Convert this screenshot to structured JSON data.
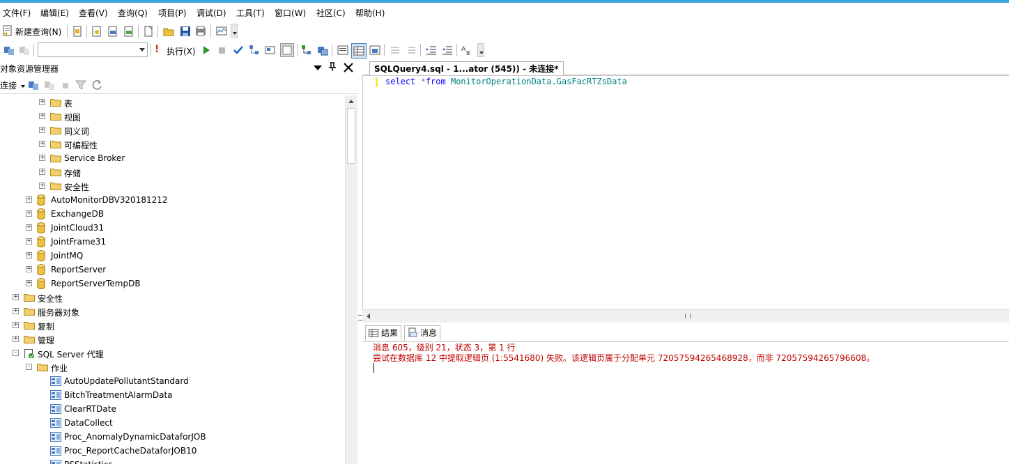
{
  "menu": [
    "文件(F)",
    "编辑(E)",
    "查看(V)",
    "查询(Q)",
    "项目(P)",
    "调试(D)",
    "工具(T)",
    "窗口(W)",
    "社区(C)",
    "帮助(H)"
  ],
  "toolbar1": {
    "new_query": "新建查询(N)"
  },
  "toolbar2": {
    "execute": "执行(X)",
    "database_select": ""
  },
  "object_explorer": {
    "title": "对象资源管理器",
    "connect": "连接",
    "nodes": [
      {
        "label": "表",
        "type": "folder"
      },
      {
        "label": "视图",
        "type": "folder"
      },
      {
        "label": "同义词",
        "type": "folder"
      },
      {
        "label": "可编程性",
        "type": "folder"
      },
      {
        "label": "Service Broker",
        "type": "folder"
      },
      {
        "label": "存储",
        "type": "folder"
      },
      {
        "label": "安全性",
        "type": "folder"
      },
      {
        "label": "AutoMonitorDBV320181212",
        "type": "db"
      },
      {
        "label": "ExchangeDB",
        "type": "db"
      },
      {
        "label": "JointCloud31",
        "type": "db"
      },
      {
        "label": "JointFrame31",
        "type": "db"
      },
      {
        "label": "JointMQ",
        "type": "db"
      },
      {
        "label": "ReportServer",
        "type": "db"
      },
      {
        "label": "ReportServerTempDB",
        "type": "db"
      },
      {
        "label": "安全性",
        "type": "folder"
      },
      {
        "label": "服务器对象",
        "type": "folder"
      },
      {
        "label": "复制",
        "type": "folder"
      },
      {
        "label": "管理",
        "type": "folder"
      },
      {
        "label": "SQL Server 代理",
        "type": "agent"
      },
      {
        "label": "作业",
        "type": "folder"
      },
      {
        "label": "AutoUpdatePollutantStandard",
        "type": "job"
      },
      {
        "label": "BitchTreatmentAlarmData",
        "type": "job"
      },
      {
        "label": "ClearRTDate",
        "type": "job"
      },
      {
        "label": "DataCollect",
        "type": "job"
      },
      {
        "label": "Proc_AnomalyDynamicDataforJOB",
        "type": "job"
      },
      {
        "label": "Proc_ReportCacheDataforJOB10",
        "type": "job"
      },
      {
        "label": "PSStatistics",
        "type": "job"
      }
    ]
  },
  "editor": {
    "tab_title": "SQLQuery4.sql - 1...ator (545)) - 未连接*",
    "code": {
      "keyword1": "select",
      "star": "*",
      "keyword2": "from",
      "object": "MonitorOperationData.GasFacRTZsData"
    }
  },
  "results": {
    "tabs": [
      "结果",
      "消息"
    ],
    "messages": [
      "消息 605，级别 21，状态 3，第 1 行",
      "尝试在数据库 12 中提取逻辑页 (1:5541680) 失败。该逻辑页属于分配单元 72057594265468928，而非 72057594265796608。"
    ]
  },
  "colors": {
    "keyword": "#0000ff",
    "object": "#008080",
    "error": "#c00000",
    "accent": "#3aa6dc"
  }
}
